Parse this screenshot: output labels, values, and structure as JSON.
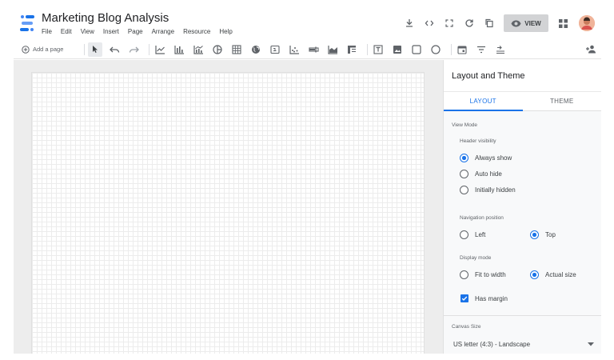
{
  "app": {
    "title": "Marketing Blog Analysis",
    "menus": [
      "File",
      "Edit",
      "View",
      "Insert",
      "Page",
      "Arrange",
      "Resource",
      "Help"
    ],
    "view_label": "VIEW",
    "accent_color": "#1a73e8"
  },
  "toolbar": {
    "add_page_label": "Add a page"
  },
  "panel": {
    "title": "Layout and Theme",
    "tabs": [
      {
        "label": "LAYOUT",
        "active": true
      },
      {
        "label": "THEME",
        "active": false
      }
    ],
    "view_mode_label": "View Mode",
    "header_visibility": {
      "label": "Header visibility",
      "options": [
        "Always show",
        "Auto hide",
        "Initially hidden"
      ],
      "selected": "Always show"
    },
    "navigation_position": {
      "label": "Navigation position",
      "options": [
        "Left",
        "Top"
      ],
      "selected": "Top"
    },
    "display_mode": {
      "label": "Display mode",
      "options": [
        "Fit to width",
        "Actual size"
      ],
      "selected": "Actual size"
    },
    "has_margin": {
      "label": "Has margin",
      "checked": true
    },
    "canvas_size": {
      "label": "Canvas Size",
      "value": "US letter (4:3) - Landscape"
    }
  }
}
